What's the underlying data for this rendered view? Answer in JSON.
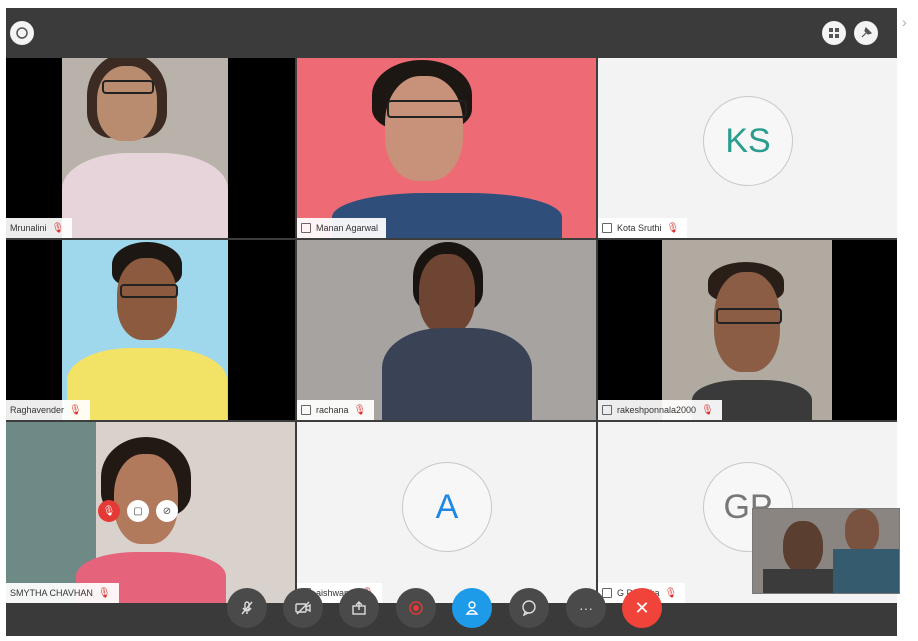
{
  "participants": [
    {
      "name": "Mrunalini"
    },
    {
      "name": "Manan Agarwal"
    },
    {
      "name": "Kota Sruthi",
      "initials": "KS"
    },
    {
      "name": "Raghavender"
    },
    {
      "name": "rachana"
    },
    {
      "name": "rakeshponnala2000"
    },
    {
      "name": "SMYTHA CHAVHAN"
    },
    {
      "name": "aishwarya",
      "initials": "A"
    },
    {
      "name": "G Pateeka",
      "initials": "GP"
    }
  ],
  "toolbar": {
    "mic_icon": "mic-icon",
    "video_icon": "video-icon",
    "share_icon": "share-icon",
    "record_icon": "record-icon",
    "participants_icon": "participants-icon",
    "chat_icon": "chat-icon",
    "more_icon": "more-icon",
    "end_call_icon": "end-call-icon",
    "more_label": "···",
    "end_label": "✕"
  },
  "colors": {
    "accent": "#1e9be8",
    "end_call": "#f0433a",
    "avatar_text": "#2a9d8f"
  }
}
